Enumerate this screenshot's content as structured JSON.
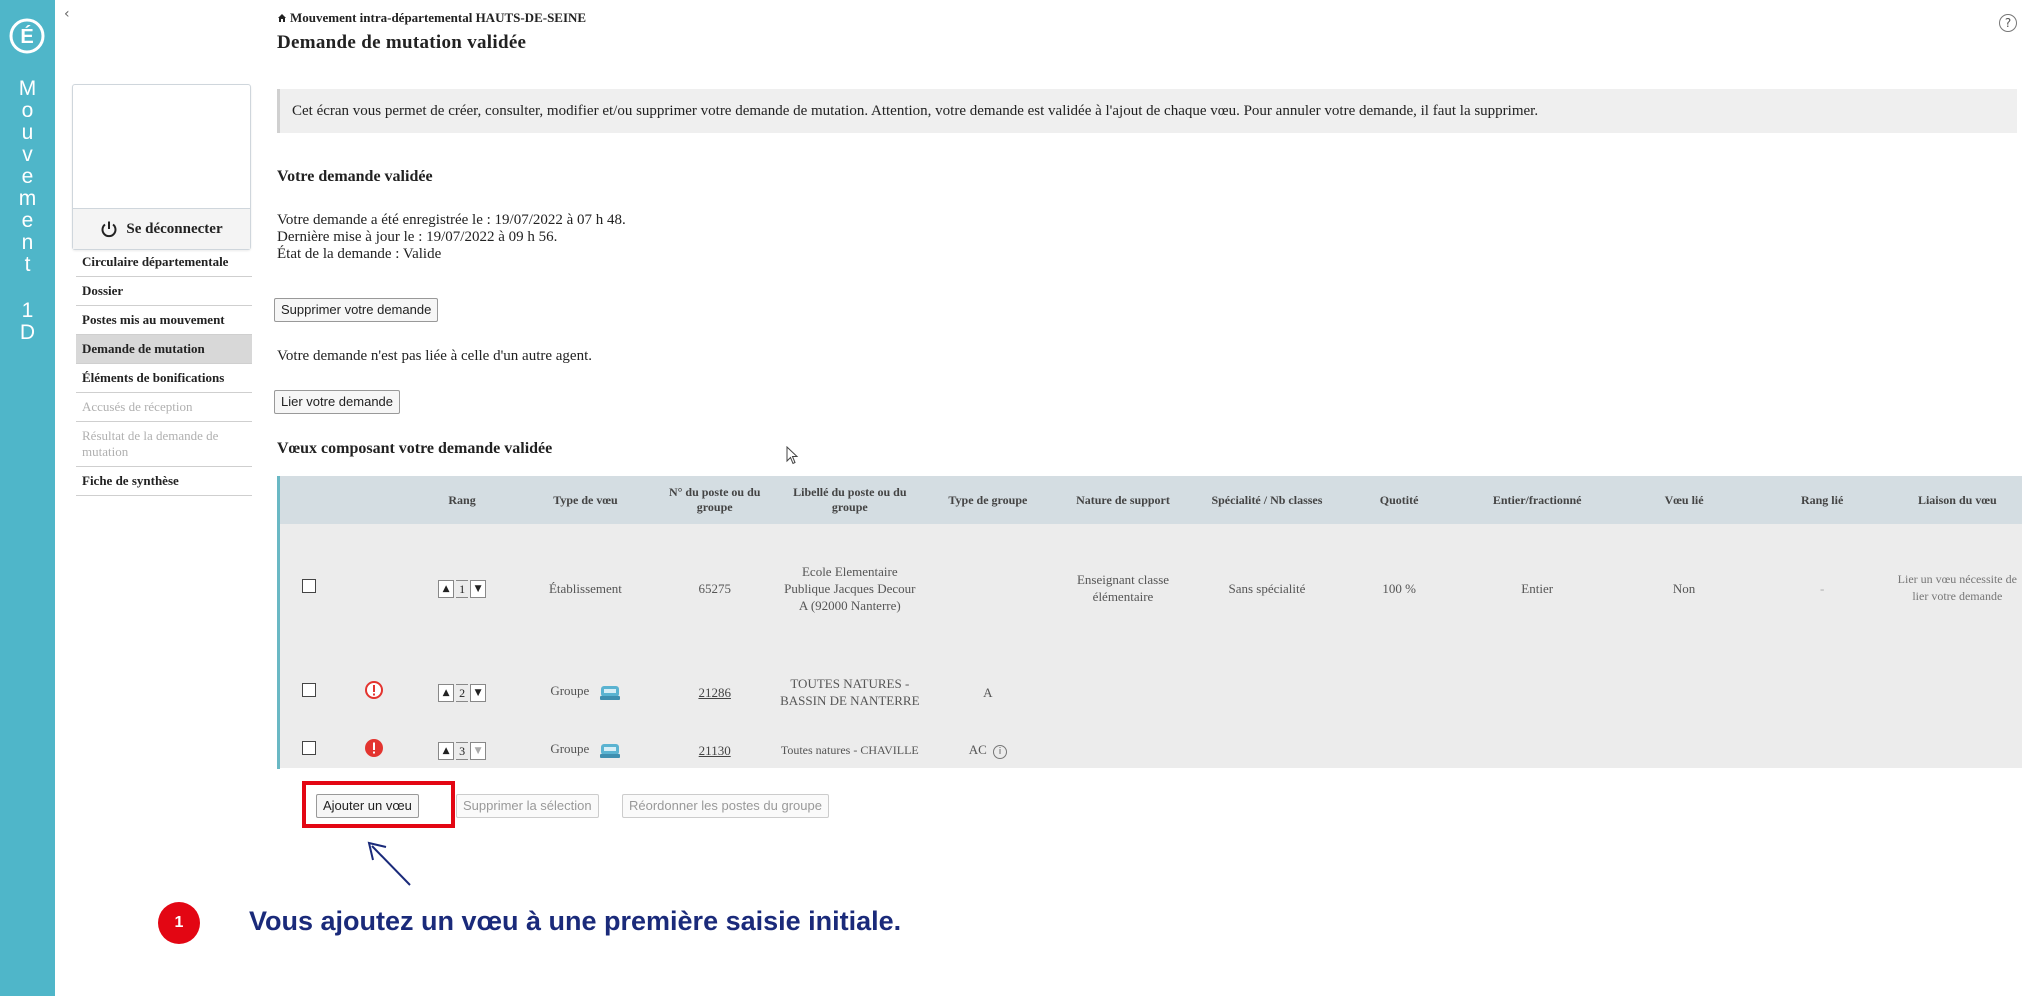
{
  "band": {
    "letters": [
      "M",
      "o",
      "u",
      "v",
      "e",
      "m",
      "e",
      "n",
      "t"
    ],
    "letters2": [
      "1",
      "D"
    ],
    "color": "#4fb6c9"
  },
  "sidebar": {
    "logout_label": "Se déconnecter",
    "items": [
      {
        "label": "Circulaire départementale",
        "state": "normal"
      },
      {
        "label": "Dossier",
        "state": "normal"
      },
      {
        "label": "Postes mis au mouvement",
        "state": "normal"
      },
      {
        "label": "Demande de mutation",
        "state": "active"
      },
      {
        "label": "Éléments de bonifications",
        "state": "normal"
      },
      {
        "label": "Accusés de réception",
        "state": "disabled"
      },
      {
        "label": "Résultat de la demande de mutation",
        "state": "disabled"
      },
      {
        "label": "Fiche de synthèse",
        "state": "normal"
      }
    ]
  },
  "header": {
    "breadcrumb": "Mouvement intra-départemental HAUTS-DE-SEINE",
    "title": "Demande de mutation validée",
    "help": "?"
  },
  "info": "Cet écran vous permet de créer, consulter, modifier et/ou supprimer votre demande de mutation. Attention, votre demande est validée à l'ajout de chaque vœu. Pour annuler votre demande, il faut la supprimer.",
  "request": {
    "section_title": "Votre demande validée",
    "registered": "Votre demande a été enregistrée le : 19/07/2022 à 07 h 48.",
    "updated": "Dernière mise à jour le : 19/07/2022 à 09 h 56.",
    "state": "État de la demande : Valide",
    "delete_button": "Supprimer votre demande",
    "link_text": "Votre demande n'est pas liée à celle d'un autre agent.",
    "link_button": "Lier votre demande"
  },
  "wishes": {
    "section_title": "Vœux composant votre demande validée",
    "columns": [
      "",
      "",
      "Rang",
      "Type de vœu",
      "N° du poste ou du groupe",
      "Libellé du poste ou du groupe",
      "Type de groupe",
      "Nature de support",
      "Spécialité / Nb classes",
      "Quotité",
      "Entier/fractionné",
      "Vœu lié",
      "Rang lié",
      "Liaison du vœu"
    ],
    "rows": [
      {
        "icon": "",
        "rank": "1",
        "type": "Établissement",
        "number": "65275",
        "label": "Ecole Elementaire Publique Jacques Decour A (92000 Nanterre)",
        "group_type": "",
        "support": "Enseignant classe élémentaire",
        "speciality": "Sans spécialité",
        "quotite": "100 %",
        "entier": "Entier",
        "linked": "Non",
        "linked_rank": "-",
        "liaison": "Lier un vœu nécessite de lier votre demande"
      },
      {
        "icon": "warning-outline",
        "rank": "2",
        "type": "Groupe",
        "number": "21286",
        "label": "TOUTES NATURES - BASSIN DE NANTERRE",
        "group_type": "A",
        "support": "",
        "speciality": "",
        "quotite": "",
        "entier": "",
        "linked": "",
        "linked_rank": "",
        "liaison": ""
      },
      {
        "icon": "warning-filled",
        "rank": "3",
        "type": "Groupe",
        "number": "21130",
        "label": "Toutes natures - CHAVILLE",
        "group_type": "AC",
        "support": "",
        "speciality": "",
        "quotite": "",
        "entier": "",
        "linked": "",
        "linked_rank": "",
        "liaison": ""
      }
    ],
    "info_icon_text": "i"
  },
  "actions": {
    "add": "Ajouter un vœu",
    "delete_selection": "Supprimer la sélection",
    "reorder": "Réordonner les postes du groupe"
  },
  "annotation": {
    "badge": "1",
    "text": "Vous ajoutez un vœu à une première saisie initiale.",
    "accent": "#e30613",
    "text_color": "#1a2a7a"
  }
}
